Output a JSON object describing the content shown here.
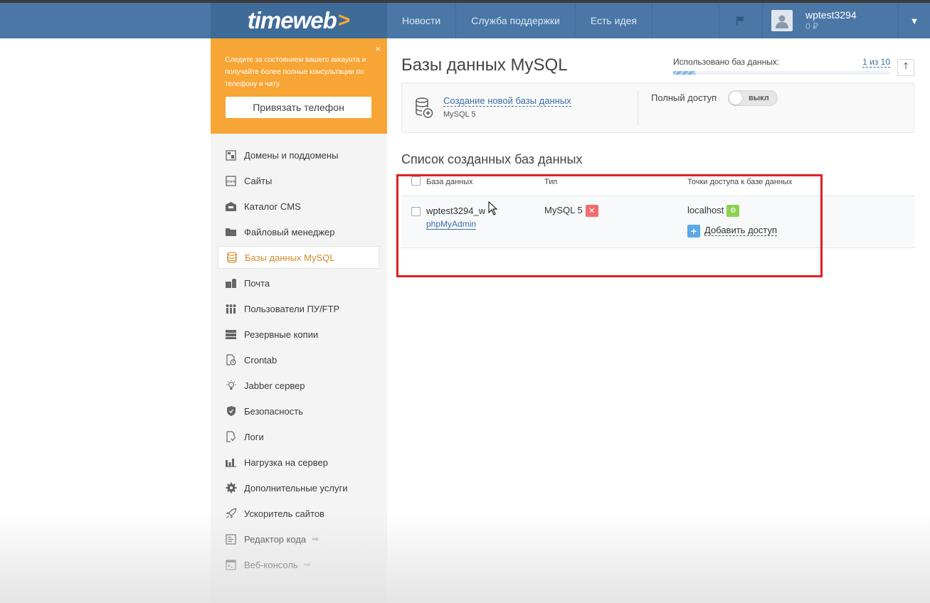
{
  "header": {
    "logo": "timeweb",
    "logo_arrow": ">",
    "nav": [
      "Новости",
      "Служба поддержки",
      "Есть идея"
    ],
    "user": {
      "name": "wptest3294",
      "balance": "0 ₽"
    }
  },
  "promo": {
    "text": "Следите за состоянием вашего аккаунта и получайте более полные консультации по телефону и чату.",
    "close": "×",
    "button": "Привязать телефон"
  },
  "sidebar": {
    "items": [
      {
        "label": "Домены и поддомены",
        "icon": "domains-icon"
      },
      {
        "label": "Сайты",
        "icon": "sites-icon"
      },
      {
        "label": "Каталог CMS",
        "icon": "cms-catalog-icon"
      },
      {
        "label": "Файловый менеджер",
        "icon": "folder-icon"
      },
      {
        "label": "Базы данных MySQL",
        "icon": "database-icon",
        "active": true
      },
      {
        "label": "Почта",
        "icon": "mail-icon"
      },
      {
        "label": "Пользователи ПУ/FTP",
        "icon": "users-icon"
      },
      {
        "label": "Резервные копии",
        "icon": "backup-icon"
      },
      {
        "label": "Crontab",
        "icon": "crontab-icon"
      },
      {
        "label": "Jabber сервер",
        "icon": "lightbulb-icon"
      },
      {
        "label": "Безопасность",
        "icon": "shield-icon"
      },
      {
        "label": "Логи",
        "icon": "logs-icon"
      },
      {
        "label": "Нагрузка на сервер",
        "icon": "bar-chart-icon"
      },
      {
        "label": "Дополнительные услуги",
        "icon": "gear-icon"
      },
      {
        "label": "Ускоритель сайтов",
        "icon": "rocket-icon"
      },
      {
        "label": "Редактор кода",
        "icon": "code-editor-icon",
        "arrow": true
      },
      {
        "label": "Веб-консоль",
        "icon": "console-icon",
        "arrow": true
      }
    ]
  },
  "main": {
    "title": "Базы данных MySQL",
    "usage_label": "Использовано баз данных:",
    "usage_count": "1 из 10",
    "usage_fraction": 0.1,
    "create_link": "Создание новой базы данных",
    "create_sub": "MySQL 5",
    "full_access_label": "Полный доступ",
    "toggle_text": "выкл",
    "list_title": "Список созданных баз данных",
    "columns": [
      "База данных",
      "Тип",
      "Точки доступа к базе данных"
    ],
    "rows": [
      {
        "name": "wptest3294_w",
        "link": "phpMyAdmin",
        "type": "MySQL 5",
        "host": "localhost",
        "add_access": "Добавить доступ"
      }
    ]
  },
  "colors": {
    "header_bg": "#4a77a6",
    "accent_orange": "#f7a535",
    "link_blue": "#3b6ea5",
    "highlight_red": "#e02020"
  }
}
